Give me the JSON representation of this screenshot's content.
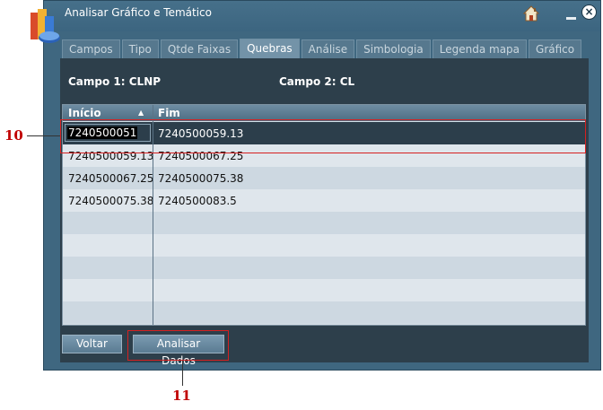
{
  "window": {
    "title": "Analisar Gráfico e Temático"
  },
  "icons": {
    "app": "app-icon",
    "home": "home-icon",
    "minimize": "minimize-icon",
    "close": "close-icon"
  },
  "tabs": [
    {
      "label": "Campos",
      "active": false
    },
    {
      "label": "Tipo",
      "active": false
    },
    {
      "label": "Qtde Faixas",
      "active": false
    },
    {
      "label": "Quebras",
      "active": true
    },
    {
      "label": "Análise",
      "active": false
    },
    {
      "label": "Simbologia",
      "active": false
    },
    {
      "label": "Legenda mapa",
      "active": false
    },
    {
      "label": "Gráfico",
      "active": false
    }
  ],
  "campo1": "Campo 1: CLNP",
  "campo2": "Campo 2: CL",
  "grid": {
    "headers": [
      "Início",
      "Fim"
    ],
    "rows": [
      [
        "7240500051",
        "7240500059.13"
      ],
      [
        "7240500059.13",
        "7240500067.25"
      ],
      [
        "7240500067.25",
        "7240500075.38"
      ],
      [
        "7240500075.38",
        "7240500083.5"
      ]
    ]
  },
  "buttons": {
    "back": "Voltar",
    "analyze": "Analisar Dados"
  },
  "annotations": {
    "row_marker": "10",
    "button_marker": "11"
  },
  "colors": {
    "annotation": "#d62020",
    "selected_row": "#2c3e4b",
    "panel": "#2d3f4b"
  }
}
